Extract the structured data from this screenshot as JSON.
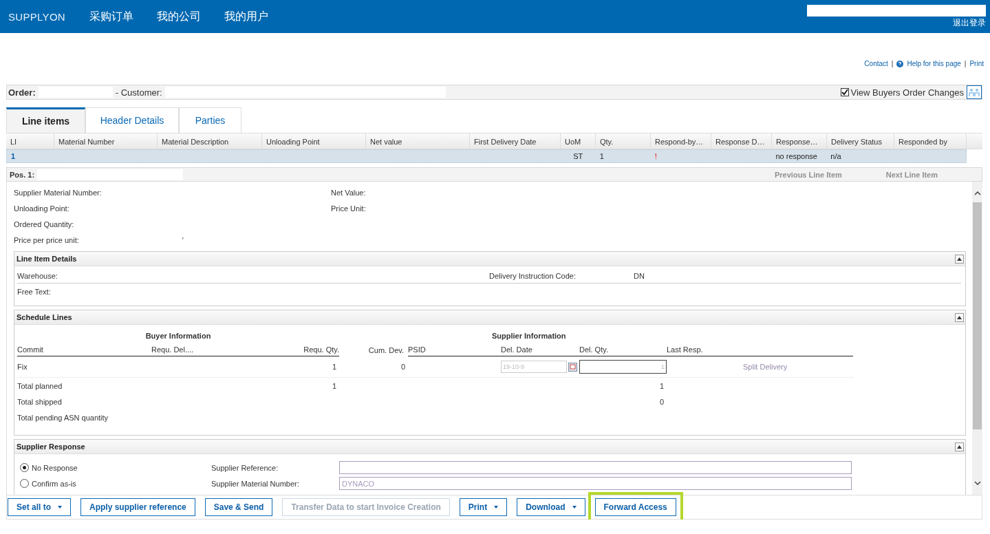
{
  "header": {
    "logo": "SUPPLYON",
    "nav": [
      {
        "label": "采购订单"
      },
      {
        "label": "我的公司"
      },
      {
        "label": "我的用户"
      }
    ],
    "logout": "退出登录"
  },
  "top_links": [
    {
      "kind": "link",
      "label": "Contact"
    },
    {
      "kind": "separator",
      "label": "|"
    },
    {
      "kind": "help",
      "label": "Help for this page"
    },
    {
      "kind": "separator",
      "label": "|"
    },
    {
      "kind": "link",
      "label": "Print"
    }
  ],
  "order": {
    "order_label": "Order:",
    "customer_label": "- Customer:",
    "view_changes": {
      "label": "View Buyers Order Changes",
      "checked": true
    }
  },
  "tabs": [
    {
      "label": "Line items",
      "selected": true
    },
    {
      "label": "Header Details",
      "selected": false
    },
    {
      "label": "Parties",
      "selected": false
    }
  ],
  "grid": {
    "columns": [
      "LI",
      "Material Number",
      "Material Description",
      "Unloading Point",
      "Net value",
      "First Delivery Date",
      "UoM",
      "Qty.",
      "Respond-by…",
      "Response D…",
      "Response…",
      "Delivery Status",
      "Responded by"
    ],
    "rows": [
      {
        "selected": true,
        "cells": [
          "1",
          null,
          null,
          null,
          null,
          null,
          "ST",
          "1",
          "!",
          null,
          "no response",
          "n/a",
          null
        ]
      }
    ]
  },
  "position": {
    "label": "Pos. 1:",
    "nav": [
      {
        "label": "Previous Line Item",
        "disabled": true
      },
      {
        "label": "Next Line Item",
        "disabled": true
      }
    ]
  },
  "item_fields": [
    [
      {
        "label": "Supplier Material Number:"
      },
      {
        "label": "Net Value:"
      }
    ],
    [
      {
        "label": "Unloading Point:"
      },
      {
        "label": "Price Unit:"
      }
    ],
    [
      {
        "label": "Ordered Quantity:"
      }
    ],
    [
      {
        "label": "Price per price unit:",
        "value": "′"
      }
    ]
  ],
  "line_item_details": {
    "title": "Line Item Details",
    "expanded": true,
    "fields": [
      {
        "label": "Warehouse:"
      },
      {
        "label": "Delivery Instruction Code:",
        "value": "DN"
      }
    ],
    "free_text": "Free Text:"
  },
  "schedule_lines": {
    "title": "Schedule Lines",
    "expanded": true,
    "buyer_header": "Buyer Information",
    "supplier_header": "Supplier Information",
    "columns": [
      "Commit",
      "Requ. Del....",
      "Requ. Qty.",
      "Cum. Dev.",
      "PSID",
      "Del. Date",
      "Del. Qty.",
      "Last Resp."
    ],
    "line": {
      "commit": "Fix",
      "requ_qty": "1",
      "cum_dev": "0",
      "del_date": "19-10-9",
      "del_qty": "1",
      "split": "Split Delivery",
      "split_disabled": true
    },
    "totals": [
      {
        "label": "Total planned",
        "buyer": "1",
        "supplier": "1"
      },
      {
        "label": "Total shipped",
        "supplier": "0"
      },
      {
        "label": "Total pending ASN quantity"
      }
    ]
  },
  "supplier_response": {
    "title": "Supplier Response",
    "expanded": true,
    "options": [
      {
        "label": "No Response",
        "selected": true
      },
      {
        "label": "Confirm as-is",
        "selected": false
      }
    ],
    "fields": [
      {
        "label": "Supplier Reference:"
      },
      {
        "label": "Supplier Material Number:",
        "value": "DYNACO"
      }
    ]
  },
  "buttons": [
    {
      "label": "Set all to",
      "dropdown": true,
      "disabled": false,
      "highlighted": false
    },
    {
      "label": "Apply supplier reference",
      "dropdown": false,
      "disabled": false,
      "highlighted": false
    },
    {
      "label": "Save & Send",
      "dropdown": false,
      "disabled": false,
      "highlighted": false
    },
    {
      "label": "Transfer Data to start Invoice Creation",
      "dropdown": false,
      "disabled": true,
      "highlighted": false
    },
    {
      "label": "Print",
      "dropdown": true,
      "disabled": false,
      "highlighted": false
    },
    {
      "label": "Download",
      "dropdown": true,
      "disabled": false,
      "highlighted": false
    },
    {
      "label": "Forward Access",
      "dropdown": false,
      "disabled": false,
      "highlighted": true
    }
  ]
}
